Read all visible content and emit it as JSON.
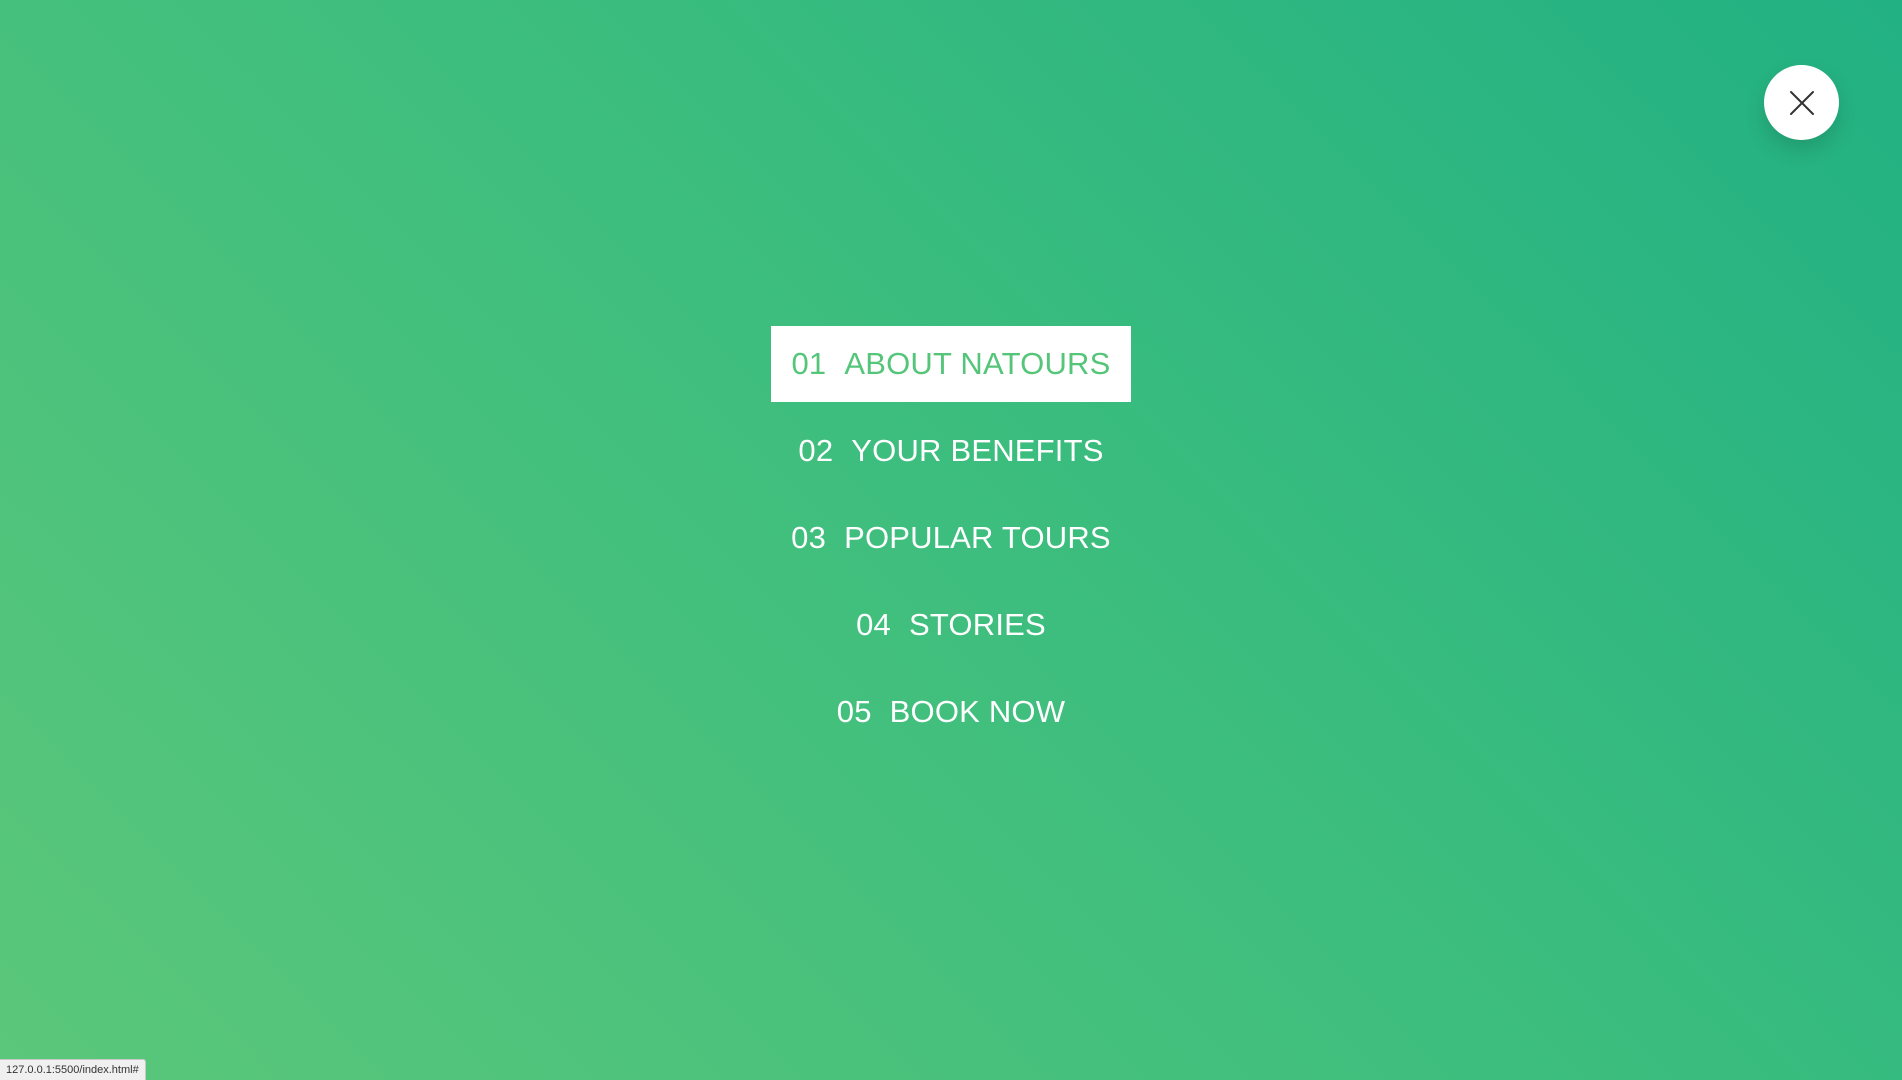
{
  "close_button": {
    "icon": "close-icon"
  },
  "navigation": {
    "items": [
      {
        "number": "01",
        "label": "ABOUT NATOURS",
        "active": true
      },
      {
        "number": "02",
        "label": "YOUR BENEFITS",
        "active": false
      },
      {
        "number": "03",
        "label": "POPULAR TOURS",
        "active": false
      },
      {
        "number": "04",
        "label": "STORIES",
        "active": false
      },
      {
        "number": "05",
        "label": "BOOK NOW",
        "active": false
      }
    ]
  },
  "status_bar": {
    "url": "127.0.0.1:5500/index.html#"
  },
  "colors": {
    "gradient_light": "#5bc77a",
    "gradient_dark": "#22b183",
    "active_text": "#55c57a",
    "text": "#ffffff"
  }
}
